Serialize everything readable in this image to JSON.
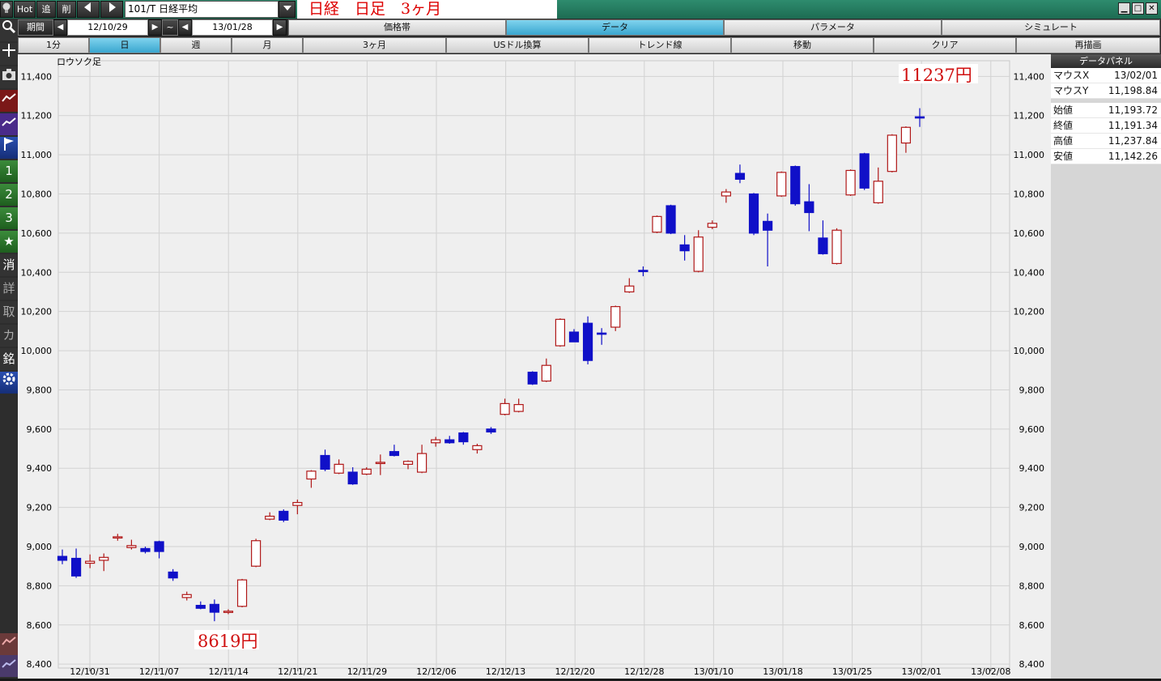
{
  "toolbar": {
    "hot_label": "Hot",
    "add_label": "追",
    "delete_label": "削",
    "symbol_value": "101/T 日経平均",
    "chart_title": "日経　日足　3ヶ月"
  },
  "sidebar": {
    "items": [
      "1",
      "2",
      "3",
      "★",
      "消",
      "詳",
      "取",
      "カ",
      "銘"
    ]
  },
  "period_bar": {
    "label": "期間",
    "from_date": "12/10/29",
    "tilde": "~",
    "to_date": "13/01/28",
    "tabs": [
      "価格帯",
      "データ",
      "パラメータ",
      "シミュレート"
    ],
    "active_tab": "データ"
  },
  "interval_bar": {
    "buttons": [
      "1分",
      "日",
      "週",
      "月",
      "3ヶ月",
      "USドル換算",
      "トレンド線",
      "移動",
      "クリア",
      "再描画"
    ],
    "active": "日"
  },
  "data_panel": {
    "title": "データパネル",
    "mouse_x_label": "マウスX",
    "mouse_x": "13/02/01",
    "mouse_y_label": "マウスY",
    "mouse_y": "11,198.84",
    "open_label": "始値",
    "open": "11,193.72",
    "close_label": "終値",
    "close": "11,191.34",
    "high_label": "高値",
    "high": "11,237.84",
    "low_label": "安値",
    "low": "11,142.26"
  },
  "chart_data": {
    "type": "candlestick",
    "series_label": "ロウソク足",
    "ylim": [
      8380,
      11480
    ],
    "yticks": [
      8400,
      8600,
      8800,
      9000,
      9200,
      9400,
      9600,
      9800,
      10000,
      10200,
      10400,
      10600,
      10800,
      11000,
      11200,
      11400
    ],
    "ytick_labels": [
      "8,400",
      "8,600",
      "8,800",
      "9,000",
      "9,200",
      "9,400",
      "9,600",
      "9,800",
      "10,000",
      "10,200",
      "10,400",
      "10,600",
      "10,800",
      "11,000",
      "11,200",
      "11,400"
    ],
    "xtick_labels": [
      "12/10/31",
      "12/11/07",
      "12/11/14",
      "12/11/21",
      "12/11/29",
      "12/12/06",
      "12/12/13",
      "12/12/20",
      "12/12/28",
      "13/01/10",
      "13/01/18",
      "13/01/25",
      "13/02/01",
      "13/02/08"
    ],
    "annotations": {
      "low_text": "8619円",
      "high_text": "11237円"
    },
    "up_color": "#b01818",
    "down_color": "#1010c8",
    "candles": [
      {
        "o": 8950,
        "h": 8985,
        "l": 8910,
        "c": 8930
      },
      {
        "o": 8940,
        "h": 8990,
        "l": 8840,
        "c": 8850
      },
      {
        "o": 8915,
        "h": 8960,
        "l": 8890,
        "c": 8925
      },
      {
        "o": 8930,
        "h": 8965,
        "l": 8875,
        "c": 8945
      },
      {
        "o": 9045,
        "h": 9065,
        "l": 9030,
        "c": 9050
      },
      {
        "o": 8995,
        "h": 9035,
        "l": 8985,
        "c": 9005
      },
      {
        "o": 8990,
        "h": 9000,
        "l": 8965,
        "c": 8975
      },
      {
        "o": 9025,
        "h": 9030,
        "l": 8940,
        "c": 8975
      },
      {
        "o": 8870,
        "h": 8885,
        "l": 8825,
        "c": 8840
      },
      {
        "o": 8740,
        "h": 8770,
        "l": 8725,
        "c": 8755
      },
      {
        "o": 8700,
        "h": 8720,
        "l": 8680,
        "c": 8685
      },
      {
        "o": 8705,
        "h": 8730,
        "l": 8619,
        "c": 8665
      },
      {
        "o": 8665,
        "h": 8680,
        "l": 8655,
        "c": 8670
      },
      {
        "o": 8695,
        "h": 8835,
        "l": 8690,
        "c": 8830
      },
      {
        "o": 8900,
        "h": 9040,
        "l": 8895,
        "c": 9030
      },
      {
        "o": 9140,
        "h": 9175,
        "l": 9135,
        "c": 9155
      },
      {
        "o": 9180,
        "h": 9190,
        "l": 9125,
        "c": 9135
      },
      {
        "o": 9210,
        "h": 9240,
        "l": 9165,
        "c": 9225
      },
      {
        "o": 9345,
        "h": 9390,
        "l": 9300,
        "c": 9385
      },
      {
        "o": 9465,
        "h": 9495,
        "l": 9385,
        "c": 9395
      },
      {
        "o": 9375,
        "h": 9445,
        "l": 9370,
        "c": 9420
      },
      {
        "o": 9380,
        "h": 9405,
        "l": 9315,
        "c": 9320
      },
      {
        "o": 9370,
        "h": 9405,
        "l": 9365,
        "c": 9395
      },
      {
        "o": 9425,
        "h": 9470,
        "l": 9365,
        "c": 9430
      },
      {
        "o": 9485,
        "h": 9520,
        "l": 9460,
        "c": 9465
      },
      {
        "o": 9420,
        "h": 9440,
        "l": 9395,
        "c": 9435
      },
      {
        "o": 9380,
        "h": 9520,
        "l": 9375,
        "c": 9475
      },
      {
        "o": 9530,
        "h": 9560,
        "l": 9510,
        "c": 9545
      },
      {
        "o": 9545,
        "h": 9565,
        "l": 9525,
        "c": 9530
      },
      {
        "o": 9580,
        "h": 9585,
        "l": 9520,
        "c": 9535
      },
      {
        "o": 9495,
        "h": 9525,
        "l": 9475,
        "c": 9515
      },
      {
        "o": 9600,
        "h": 9610,
        "l": 9575,
        "c": 9585
      },
      {
        "o": 9675,
        "h": 9755,
        "l": 9670,
        "c": 9730
      },
      {
        "o": 9690,
        "h": 9755,
        "l": 9685,
        "c": 9725
      },
      {
        "o": 9890,
        "h": 9895,
        "l": 9825,
        "c": 9830
      },
      {
        "o": 9845,
        "h": 9960,
        "l": 9840,
        "c": 9925
      },
      {
        "o": 10025,
        "h": 10165,
        "l": 10020,
        "c": 10160
      },
      {
        "o": 10095,
        "h": 10110,
        "l": 10045,
        "c": 10045
      },
      {
        "o": 10140,
        "h": 10175,
        "l": 9930,
        "c": 9950
      },
      {
        "o": 10090,
        "h": 10115,
        "l": 10030,
        "c": 10085
      },
      {
        "o": 10120,
        "h": 10230,
        "l": 10100,
        "c": 10225
      },
      {
        "o": 10300,
        "h": 10370,
        "l": 10295,
        "c": 10330
      },
      {
        "o": 10410,
        "h": 10430,
        "l": 10380,
        "c": 10405
      },
      {
        "o": 10605,
        "h": 10690,
        "l": 10600,
        "c": 10685
      },
      {
        "o": 10740,
        "h": 10745,
        "l": 10595,
        "c": 10600
      },
      {
        "o": 10540,
        "h": 10590,
        "l": 10460,
        "c": 10510
      },
      {
        "o": 10405,
        "h": 10615,
        "l": 10400,
        "c": 10580
      },
      {
        "o": 10630,
        "h": 10665,
        "l": 10620,
        "c": 10650
      },
      {
        "o": 10790,
        "h": 10825,
        "l": 10755,
        "c": 10810
      },
      {
        "o": 10905,
        "h": 10950,
        "l": 10855,
        "c": 10875
      },
      {
        "o": 10800,
        "h": 10805,
        "l": 10590,
        "c": 10600
      },
      {
        "o": 10660,
        "h": 10700,
        "l": 10430,
        "c": 10615
      },
      {
        "o": 10790,
        "h": 10915,
        "l": 10785,
        "c": 10910
      },
      {
        "o": 10940,
        "h": 10945,
        "l": 10740,
        "c": 10750
      },
      {
        "o": 10760,
        "h": 10850,
        "l": 10610,
        "c": 10705
      },
      {
        "o": 10575,
        "h": 10665,
        "l": 10490,
        "c": 10495
      },
      {
        "o": 10445,
        "h": 10625,
        "l": 10440,
        "c": 10615
      },
      {
        "o": 10795,
        "h": 10925,
        "l": 10790,
        "c": 10920
      },
      {
        "o": 11005,
        "h": 11010,
        "l": 10820,
        "c": 10830
      },
      {
        "o": 10755,
        "h": 10935,
        "l": 10750,
        "c": 10865
      },
      {
        "o": 10915,
        "h": 11105,
        "l": 10910,
        "c": 11100
      },
      {
        "o": 11060,
        "h": 11145,
        "l": 11010,
        "c": 11140
      },
      {
        "o": 11193.72,
        "h": 11237.84,
        "l": 11142.26,
        "c": 11191.34
      }
    ]
  }
}
